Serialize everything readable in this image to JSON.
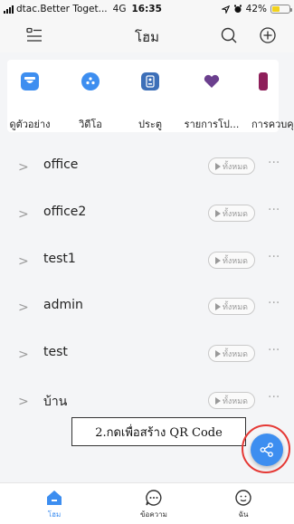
{
  "status_bar": {
    "carrier": "dtac.Better Toget...",
    "network": "4G",
    "time": "16:35",
    "battery": "42%",
    "battery_level": 0.42,
    "battery_color": "#f2d21b"
  },
  "header": {
    "title": "โฮม",
    "menu_icon": "menu-icon",
    "search_icon": "search-icon",
    "add_icon": "add-circle-icon"
  },
  "quick_actions": [
    {
      "label": "ดูตัวอย่าง",
      "icon": "camera-icon",
      "color": "#3d8ef0"
    },
    {
      "label": "วิดีโอ",
      "icon": "video-icon",
      "color": "#3d8ef0"
    },
    {
      "label": "ประตู",
      "icon": "door-icon",
      "color": "#3d6fb8"
    },
    {
      "label": "รายการโป...",
      "icon": "heart-icon",
      "color": "#6b3f8e"
    },
    {
      "label": "การควบคุ",
      "icon": "control-icon",
      "color": "#8e1f5a"
    }
  ],
  "devices": [
    {
      "name": "office",
      "action_label": "ทั้งหมด"
    },
    {
      "name": "office2",
      "action_label": "ทั้งหมด"
    },
    {
      "name": "test1",
      "action_label": "ทั้งหมด"
    },
    {
      "name": "admin",
      "action_label": "ทั้งหมด"
    },
    {
      "name": "test",
      "action_label": "ทั้งหมด"
    },
    {
      "name": "บ้าน",
      "action_label": "ทั้งหมด"
    }
  ],
  "annotation": {
    "text": "2.กดเพื่อสร้าง QR Code",
    "highlight_color": "#e53935"
  },
  "fab": {
    "icon": "share-icon",
    "color": "#3d8ef0"
  },
  "tab_bar": {
    "tabs": [
      {
        "label": "โฮม",
        "icon": "home-icon",
        "active": true
      },
      {
        "label": "ข้อความ",
        "icon": "message-icon",
        "active": false
      },
      {
        "label": "ฉัน",
        "icon": "profile-icon",
        "active": false
      }
    ],
    "active_color": "#3d8ef0"
  }
}
